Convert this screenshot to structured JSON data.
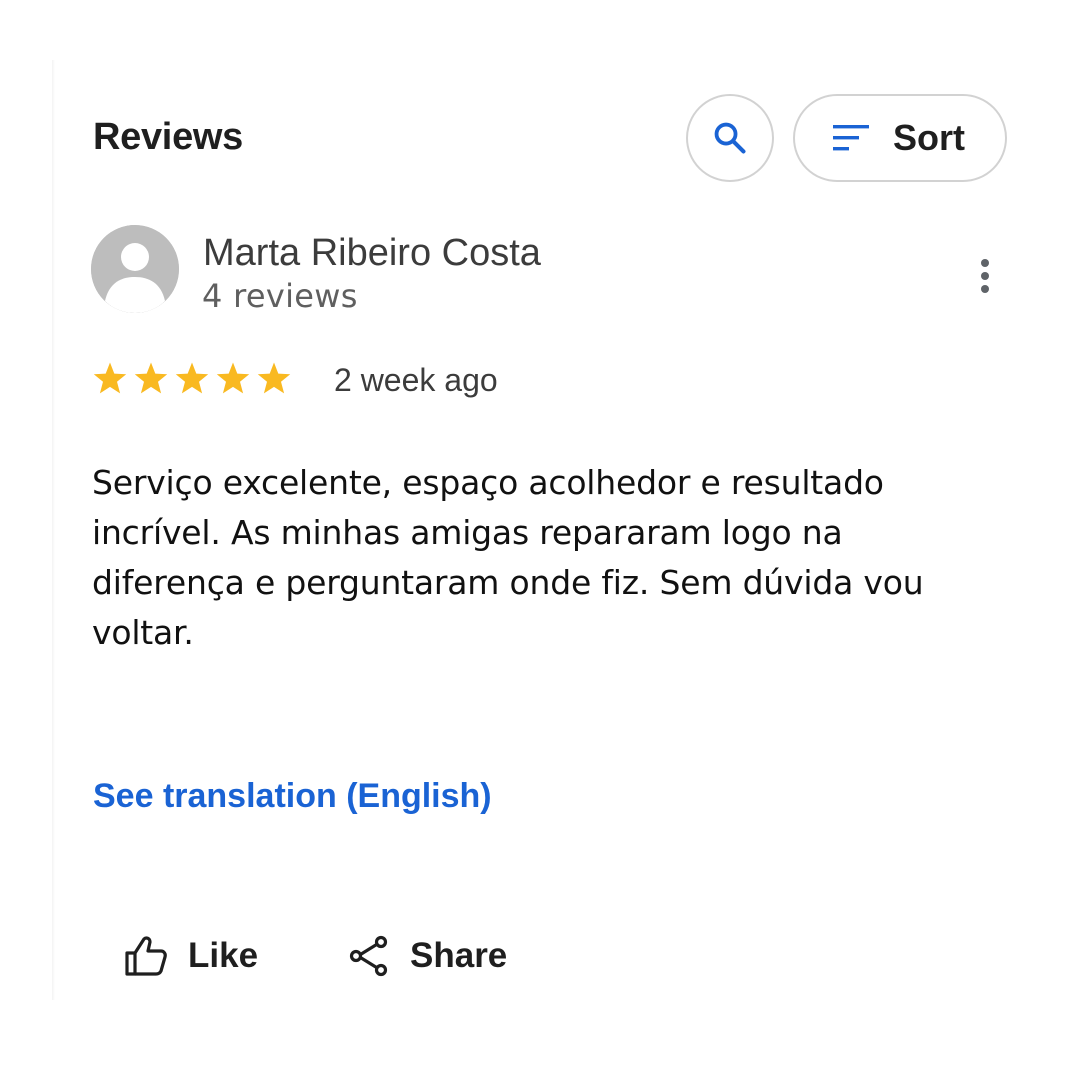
{
  "header": {
    "title": "Reviews",
    "search_icon": "search-icon",
    "sort_label": "Sort",
    "sort_icon": "sort-lines-icon"
  },
  "review": {
    "author": "Marta Ribeiro Costa",
    "author_reviews": "4 reviews",
    "rating": 5,
    "rating_max": 5,
    "time": "2 week ago",
    "text": "Serviço excelente, espaço acolhedor e resultado incrível. As minhas amigas repararam logo na diferença e perguntaram onde fiz. Sem dúvida vou voltar.",
    "translate_link": "See translation (English)"
  },
  "actions": {
    "like_label": "Like",
    "share_label": "Share"
  },
  "colors": {
    "accent_blue": "#1a63d4",
    "star": "#f9b921",
    "avatar_bg": "#bdbdbd",
    "text_dark": "#1f1f1f"
  }
}
